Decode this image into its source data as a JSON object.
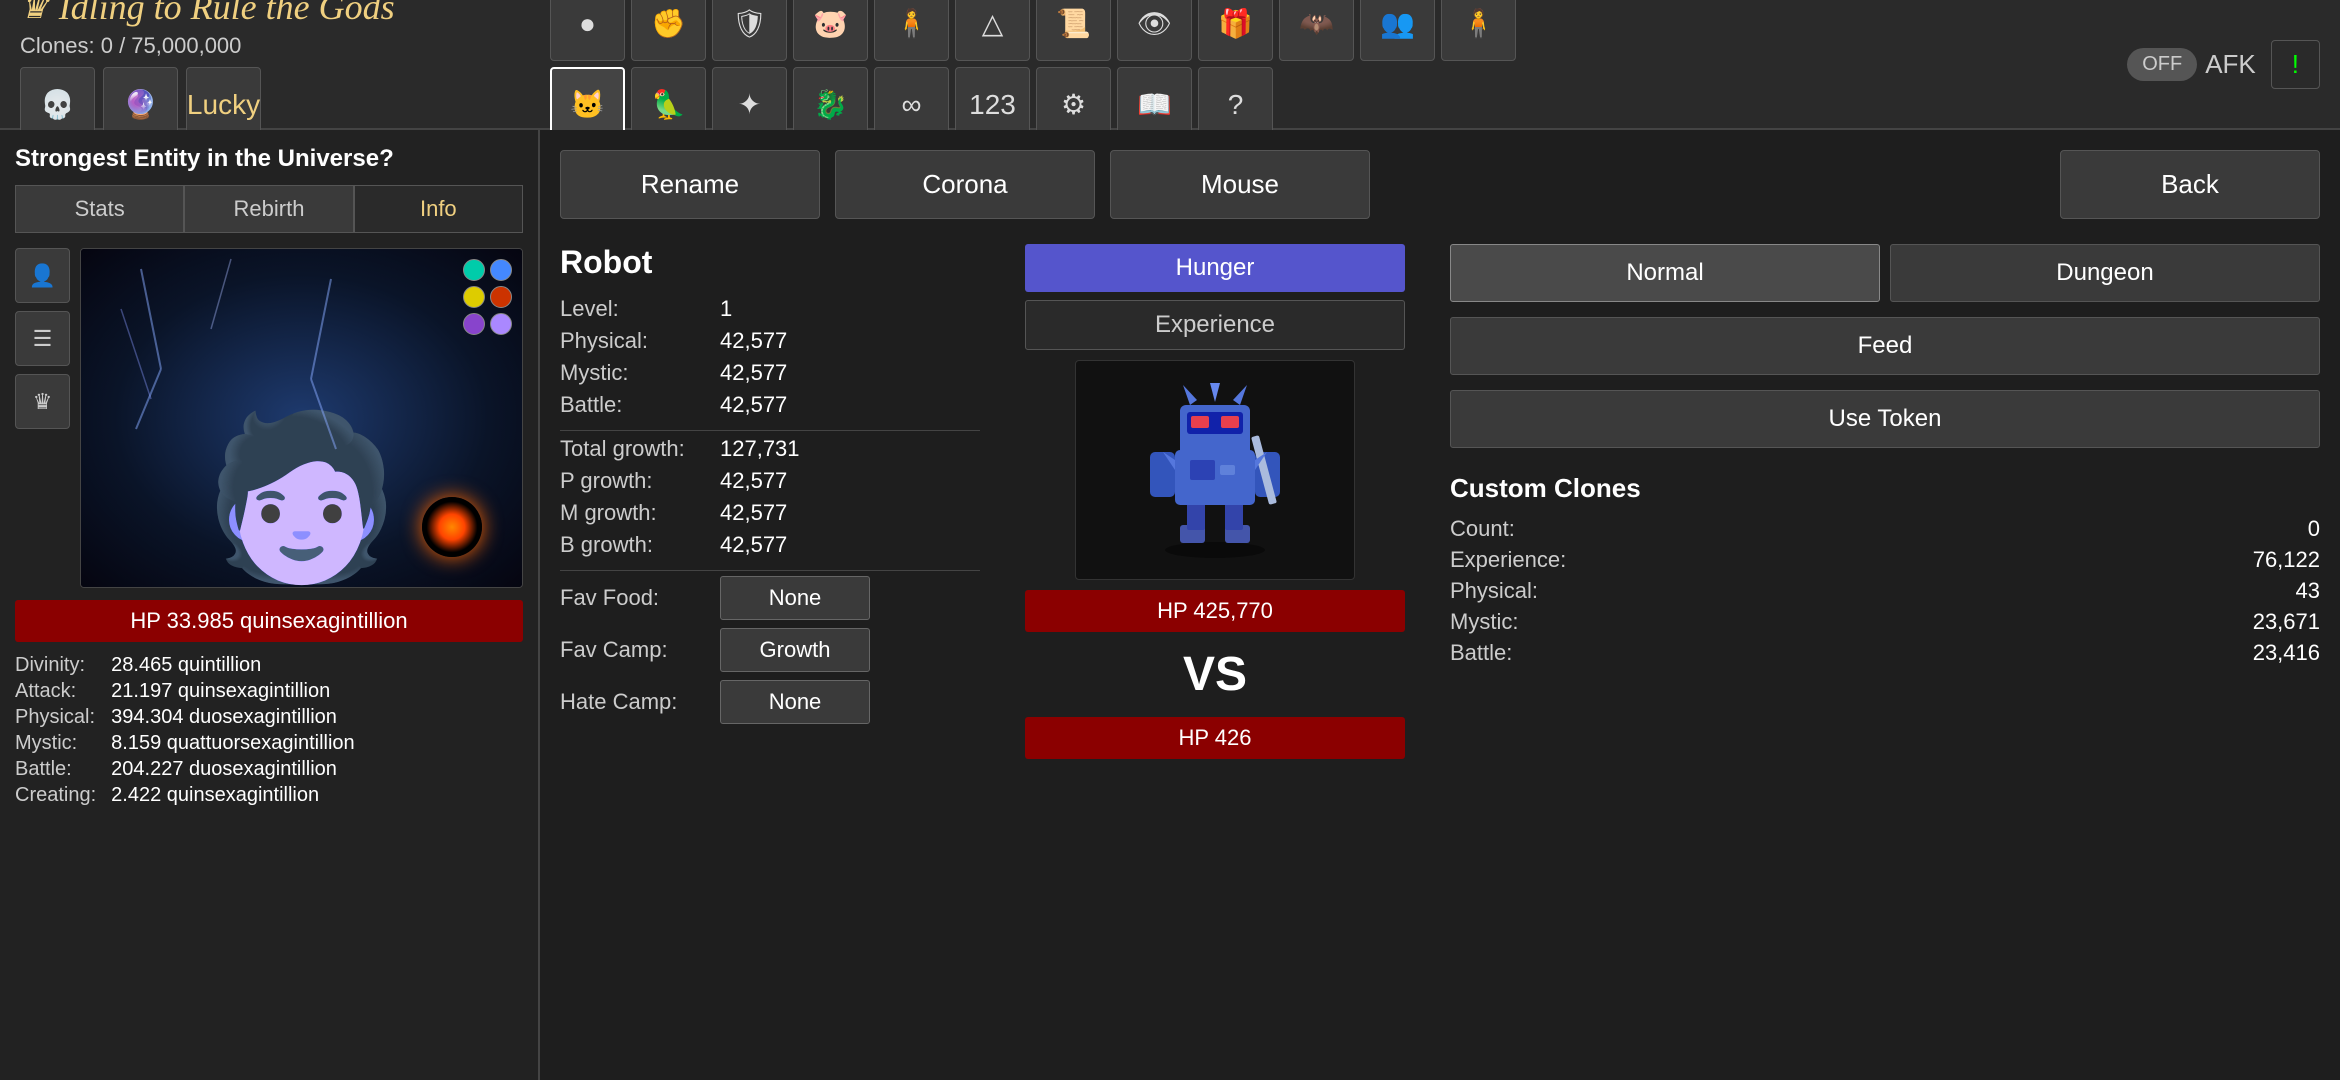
{
  "app": {
    "title": "Idling to Rule the Gods",
    "clones_label": "Clones:",
    "clones_value": "0 / 75,000,000"
  },
  "toolbar": {
    "icons": [
      {
        "name": "light-icon",
        "symbol": "●"
      },
      {
        "name": "fist-icon",
        "symbol": "✊"
      },
      {
        "name": "shield-icon",
        "symbol": "🛡"
      },
      {
        "name": "pig-icon",
        "symbol": "🐷"
      },
      {
        "name": "person-icon",
        "symbol": "🧍"
      },
      {
        "name": "pyramid-icon",
        "symbol": "△"
      },
      {
        "name": "scroll-icon",
        "symbol": "📜"
      },
      {
        "name": "eye-icon",
        "symbol": "👁"
      },
      {
        "name": "chest-icon",
        "symbol": "🎁"
      },
      {
        "name": "wings-icon",
        "symbol": "🦇"
      },
      {
        "name": "people-icon",
        "symbol": "👥"
      },
      {
        "name": "figure-icon",
        "symbol": "🧍"
      }
    ],
    "icons2": [
      {
        "name": "cat-icon",
        "symbol": "🐱",
        "active": true
      },
      {
        "name": "bird-icon",
        "symbol": "🦜"
      },
      {
        "name": "cross-icon",
        "symbol": "✦"
      },
      {
        "name": "dragon-icon",
        "symbol": "🐉"
      },
      {
        "name": "infinity-icon",
        "symbol": "∞"
      },
      {
        "name": "number-icon",
        "symbol": "123"
      },
      {
        "name": "gear-icon",
        "symbol": "⚙"
      },
      {
        "name": "book-icon",
        "symbol": "📖"
      },
      {
        "name": "question-icon",
        "symbol": "?"
      }
    ],
    "afk_toggle": "OFF",
    "afk_label": "AFK",
    "notification": "!"
  },
  "left_panel": {
    "title": "Strongest Entity in the Universe?",
    "tabs": [
      "Stats",
      "Rebirth",
      "Info"
    ],
    "active_tab": "Info",
    "hp_bar": "HP 33.985 quinsexagintillion",
    "stats": [
      {
        "label": "Divinity:",
        "value": "28.465 quintillion"
      },
      {
        "label": "Attack:",
        "value": "21.197 quinsexagintillion"
      },
      {
        "label": "Physical:",
        "value": "394.304 duosexagintillion"
      },
      {
        "label": "Mystic:",
        "value": "8.159 quattuorsexagintillion"
      },
      {
        "label": "Battle:",
        "value": "204.227 duosexagintillion"
      },
      {
        "label": "Creating:",
        "value": "2.422 quinsexagintillion"
      }
    ]
  },
  "right_panel": {
    "buttons": {
      "rename": "Rename",
      "corona": "Corona",
      "mouse": "Mouse",
      "back": "Back"
    },
    "pet": {
      "name": "Robot",
      "level_label": "Level:",
      "level_value": "1",
      "physical_label": "Physical:",
      "physical_value": "42,577",
      "mystic_label": "Mystic:",
      "mystic_value": "42,577",
      "battle_label": "Battle:",
      "battle_value": "42,577",
      "total_growth_label": "Total growth:",
      "total_growth_value": "127,731",
      "p_growth_label": "P growth:",
      "p_growth_value": "42,577",
      "m_growth_label": "M growth:",
      "m_growth_value": "42,577",
      "b_growth_label": "B growth:",
      "b_growth_value": "42,577",
      "fav_food_label": "Fav Food:",
      "fav_food_value": "None",
      "fav_camp_label": "Fav Camp:",
      "fav_camp_value": "Growth",
      "hate_camp_label": "Hate Camp:",
      "hate_camp_value": "None"
    },
    "battle": {
      "hunger_label": "Hunger",
      "experience_label": "Experience",
      "pet_hp": "HP 425,770",
      "vs_text": "VS",
      "player_hp": "HP 426"
    },
    "modes": {
      "normal": "Normal",
      "dungeon": "Dungeon",
      "feed": "Feed",
      "use_token": "Use Token"
    },
    "custom_clones": {
      "title": "Custom Clones",
      "count_label": "Count:",
      "count_value": "0",
      "experience_label": "Experience:",
      "experience_value": "76,122",
      "physical_label": "Physical:",
      "physical_value": "43",
      "mystic_label": "Mystic:",
      "mystic_value": "23,671",
      "battle_label": "Battle:",
      "battle_value": "23,416"
    }
  }
}
